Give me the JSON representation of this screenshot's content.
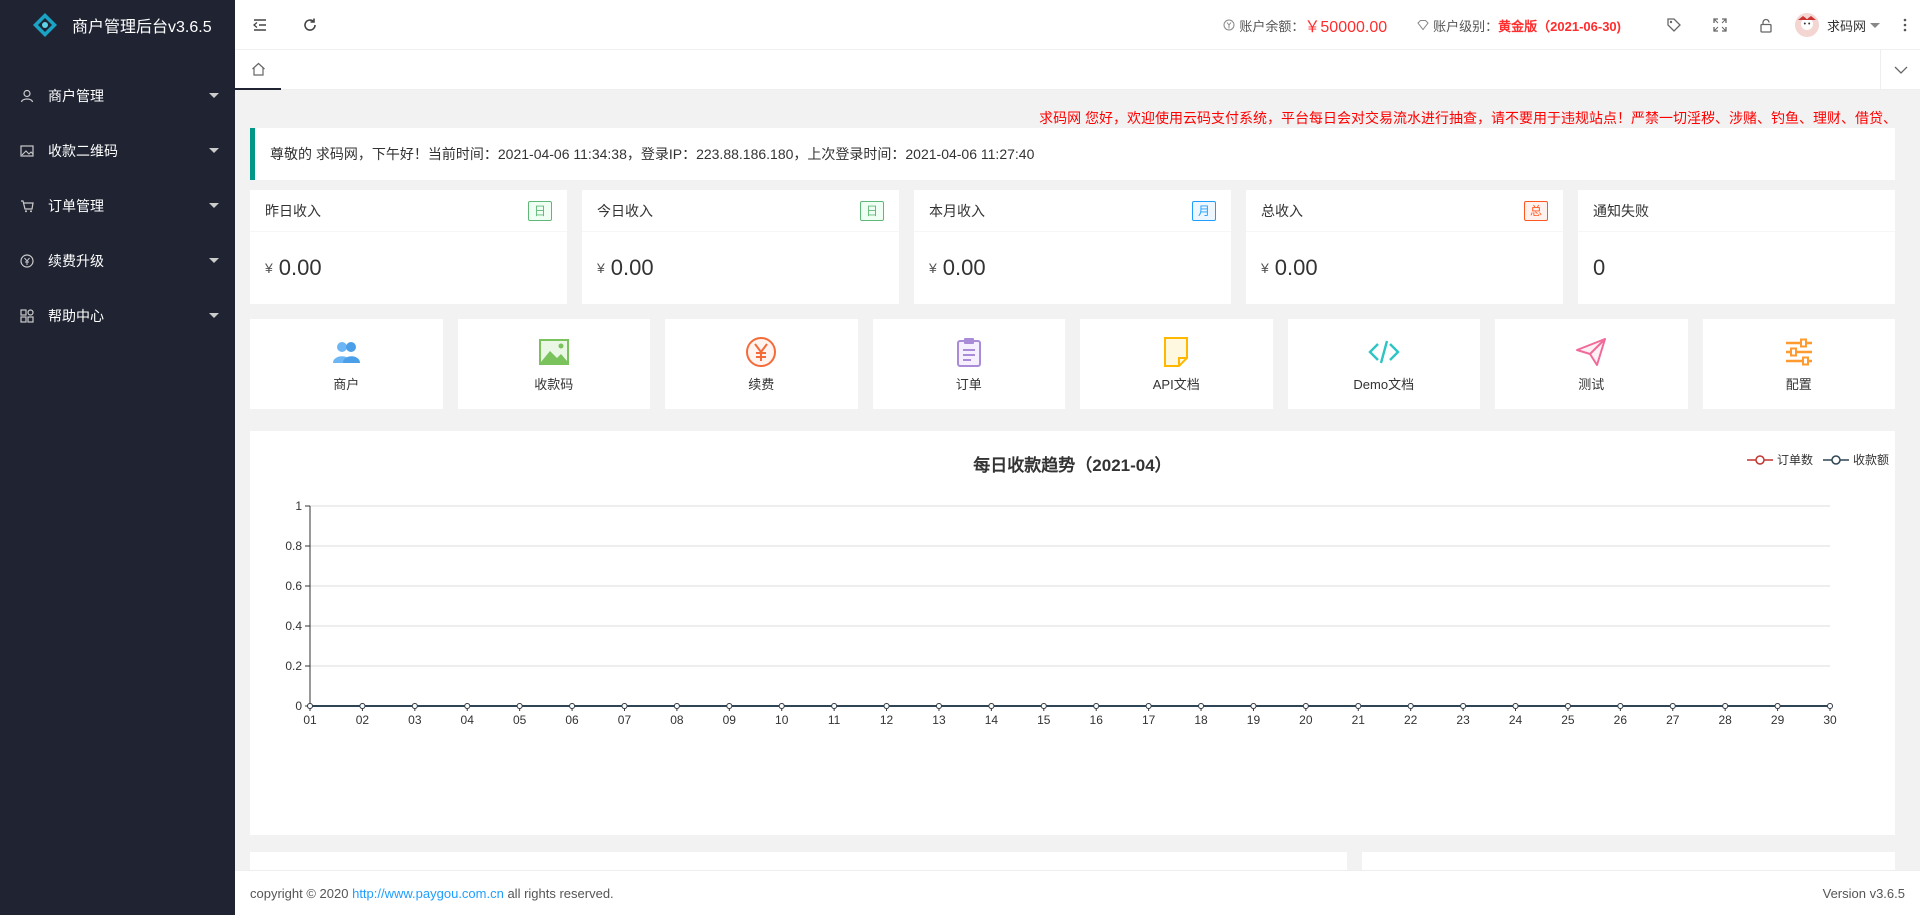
{
  "sidebar": {
    "title": "商户管理后台v3.6.5",
    "items": [
      {
        "label": "商户管理",
        "icon": "user-icon"
      },
      {
        "label": "收款二维码",
        "icon": "image-icon"
      },
      {
        "label": "订单管理",
        "icon": "cart-icon"
      },
      {
        "label": "续费升级",
        "icon": "yen-circle-icon"
      },
      {
        "label": "帮助中心",
        "icon": "apps-icon"
      }
    ]
  },
  "header": {
    "balance_label": "账户余额：",
    "balance_value": "￥50000.00",
    "level_label": "账户级别：",
    "level_value": "黄金版（2021-06-30)",
    "username": "求码网"
  },
  "marquee": "求码网 您好，欢迎使用云码支付系统，平台每日会对交易流水进行抽查，请不要用于违规站点！严禁一切淫秽、涉赌、钓鱼、理财、借贷、",
  "welcome": "尊敬的 求码网，下午好！当前时间：2021-04-06 11:34:38，登录IP：223.88.186.180，上次登录时间：2021-04-06 11:27:40",
  "stats": [
    {
      "label": "昨日收入",
      "badge": "日",
      "badge_color": "#5FB878",
      "currency": "¥",
      "value": "0.00"
    },
    {
      "label": "今日收入",
      "badge": "日",
      "badge_color": "#5FB878",
      "currency": "¥",
      "value": "0.00"
    },
    {
      "label": "本月收入",
      "badge": "月",
      "badge_color": "#1E9FFF",
      "currency": "¥",
      "value": "0.00"
    },
    {
      "label": "总收入",
      "badge": "总",
      "badge_color": "#FF5722",
      "currency": "¥",
      "value": "0.00"
    },
    {
      "label": "通知失败",
      "value": "0"
    }
  ],
  "shortcuts": [
    {
      "label": "商户",
      "icon": "users-icon",
      "color": "#1E9FFF"
    },
    {
      "label": "收款码",
      "icon": "picture-icon",
      "color": "#5FB878"
    },
    {
      "label": "续费",
      "icon": "yen-icon",
      "color": "#FF5722"
    },
    {
      "label": "订单",
      "icon": "clipboard-icon",
      "color": "#a98bd8"
    },
    {
      "label": "API文档",
      "icon": "document-icon",
      "color": "#FFB800"
    },
    {
      "label": "Demo文档",
      "icon": "code-icon",
      "color": "#2fc4c4"
    },
    {
      "label": "测试",
      "icon": "send-icon",
      "color": "#f06a9a"
    },
    {
      "label": "配置",
      "icon": "sliders-icon",
      "color": "#ff9a2e"
    }
  ],
  "chart_data": {
    "type": "line",
    "title": "每日收款趋势（2021-04）",
    "x": [
      "01",
      "02",
      "03",
      "04",
      "05",
      "06",
      "07",
      "08",
      "09",
      "10",
      "11",
      "12",
      "13",
      "14",
      "15",
      "16",
      "17",
      "18",
      "19",
      "20",
      "21",
      "22",
      "23",
      "24",
      "25",
      "26",
      "27",
      "28",
      "29",
      "30"
    ],
    "series": [
      {
        "name": "订单数",
        "color": "#c23531",
        "values": [
          0,
          0,
          0,
          0,
          0,
          0,
          0,
          0,
          0,
          0,
          0,
          0,
          0,
          0,
          0,
          0,
          0,
          0,
          0,
          0,
          0,
          0,
          0,
          0,
          0,
          0,
          0,
          0,
          0,
          0
        ]
      },
      {
        "name": "收款额",
        "color": "#2f4554",
        "values": [
          0,
          0,
          0,
          0,
          0,
          0,
          0,
          0,
          0,
          0,
          0,
          0,
          0,
          0,
          0,
          0,
          0,
          0,
          0,
          0,
          0,
          0,
          0,
          0,
          0,
          0,
          0,
          0,
          0,
          0
        ]
      }
    ],
    "ylim": [
      0,
      1
    ],
    "yticks": [
      "0",
      "0.2",
      "0.4",
      "0.6",
      "0.8",
      "1"
    ],
    "legend": "top-right",
    "grid": true
  },
  "footer": {
    "copyright_prefix": "copyright © 2020 ",
    "link": "http://www.paygou.com.cn",
    "copyright_suffix": " all rights reserved.",
    "version": "Version v3.6.5"
  }
}
